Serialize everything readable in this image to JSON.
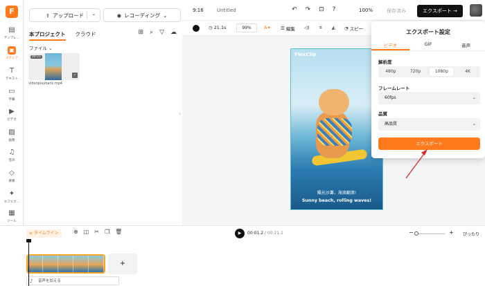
{
  "rail": {
    "logo": "F",
    "items": [
      {
        "label": "テンプレ…",
        "icon": "template-icon"
      },
      {
        "label": "メディア",
        "icon": "media-icon"
      },
      {
        "label": "テキスト",
        "icon": "text-icon"
      },
      {
        "label": "字幕",
        "icon": "subtitle-icon"
      },
      {
        "label": "ビデオ",
        "icon": "video-icon"
      },
      {
        "label": "画像",
        "icon": "image-icon"
      },
      {
        "label": "音声",
        "icon": "audio-icon"
      },
      {
        "label": "要素",
        "icon": "element-icon"
      },
      {
        "label": "エフェク…",
        "icon": "effect-icon"
      },
      {
        "label": "ツール",
        "icon": "tool-icon"
      }
    ]
  },
  "panel": {
    "upload_label": "アップロード",
    "record_label": "レコーディング",
    "tab_project": "本プロジェクト",
    "tab_cloud": "クラウド",
    "file_label": "ファイル ⌄",
    "thumb_duration": "00:21",
    "file_name": "videoplayback.mp4"
  },
  "topbar": {
    "aspect": "9:16",
    "title": "Untitled",
    "zoom": "100%",
    "save_label": "保存済み",
    "export_label": "エクスポート →"
  },
  "toolbar": {
    "duration": "21.1s",
    "zoom": "99%",
    "edit_label": "編集",
    "speed_label": "スピー"
  },
  "video": {
    "brand": "FlexClip",
    "caption_jp": "陽光沙灘，海浪翻滾!",
    "caption_en": "Sunny beach, rolling waves!"
  },
  "export_popup": {
    "title": "エクスポート設定",
    "tabs": [
      "ビデオ",
      "GIF",
      "音声"
    ],
    "resolution_label": "解析度",
    "resolutions": [
      "480p",
      "720p",
      "1080p",
      "4K"
    ],
    "selected_resolution": "1080p",
    "framerate_label": "フレームレート",
    "framerate_value": "60fps",
    "quality_label": "品質",
    "quality_value": "高品質",
    "export_button": "エクスポート"
  },
  "timeline": {
    "tab_label": "タイムライン",
    "current_time": "00:01.2",
    "total_time": "/ 00:21.1",
    "fit_label": "ぴったり",
    "add_audio_label": "音声を加える",
    "add_clip": "+"
  },
  "colors": {
    "accent": "#ff7a1a",
    "annotation_arrow": "#d62a2a"
  }
}
